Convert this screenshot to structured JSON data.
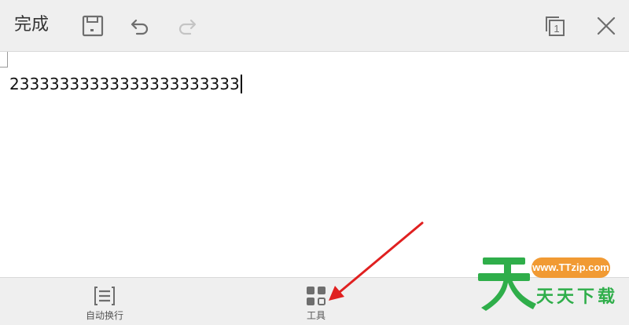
{
  "toolbar": {
    "done_label": "完成",
    "icons": {
      "save": "save-icon",
      "undo": "undo-icon",
      "redo": "redo-icon",
      "pages": "page-count-icon",
      "close": "close-icon"
    },
    "page_count": "1"
  },
  "editor": {
    "text": "23333333333333333333333"
  },
  "bottom": {
    "items": [
      {
        "label": "自动换行",
        "icon": "word-wrap-icon"
      },
      {
        "label": "工具",
        "icon": "tools-grid-icon"
      }
    ]
  },
  "watermark": {
    "url": "www.TTzip.com",
    "name": "天天下载"
  },
  "colors": {
    "toolbar_bg": "#efefef",
    "icon_gray": "#6e6e6e",
    "icon_disabled": "#c4c4c4",
    "annotation_arrow": "#e02020",
    "watermark_green": "#2fae4a",
    "watermark_orange": "#f19a33"
  }
}
